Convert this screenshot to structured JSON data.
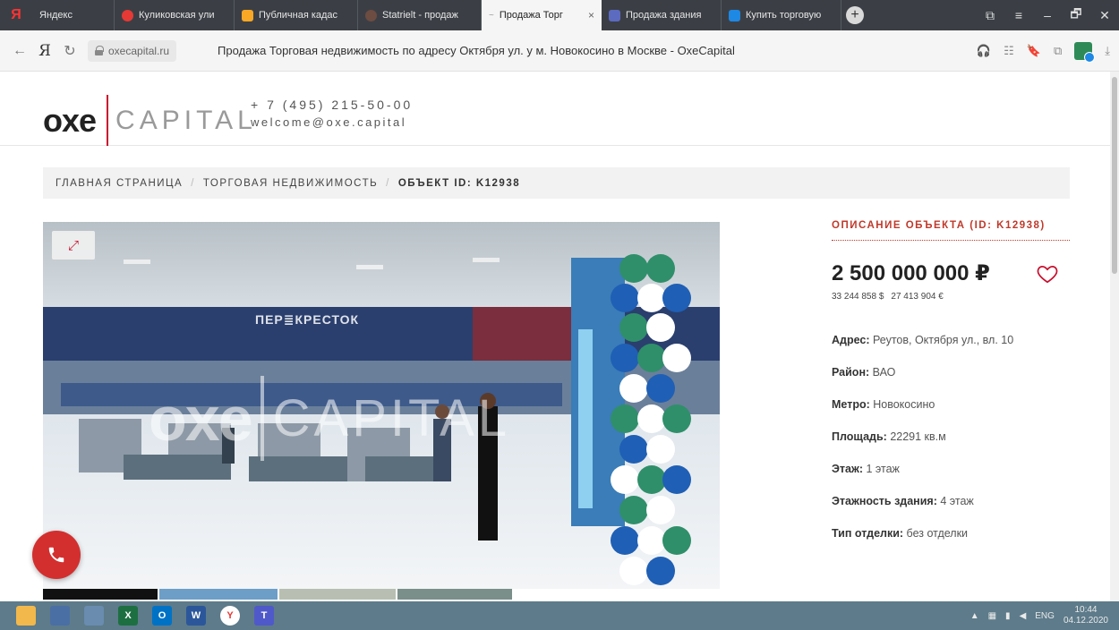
{
  "browser": {
    "yandex_glyph": "Я",
    "tabs": [
      {
        "label": "Яндекс",
        "favicon_color": "#3b3f45"
      },
      {
        "label": "Куликовская ули",
        "favicon_color": "#e53935"
      },
      {
        "label": "Публичная кадас",
        "favicon_color": "#f9a825"
      },
      {
        "label": "Statrielt - продаж",
        "favicon_color": "#6d4c41"
      },
      {
        "label": "Продажа Торг",
        "favicon_color": "#c8102e",
        "active": true
      },
      {
        "label": "Продажа здания",
        "favicon_color": "#5c6bc0"
      },
      {
        "label": "Купить торговую",
        "favicon_color": "#1e88e5"
      }
    ],
    "new_tab_glyph": "+",
    "close_glyph": "×",
    "window_controls": [
      "⧉",
      "≡",
      "‒",
      "🗗",
      "✕"
    ],
    "address": {
      "domain": "oxecapital.ru",
      "page_title": "Продажа Торговая недвижимость по адресу Октября ул. у м. Новокосино в Москве - OxeCapital"
    },
    "nav_glyphs": {
      "back": "←",
      "yandex": "Я",
      "reload": "↻"
    },
    "right_glyphs": [
      "🎧",
      "☷",
      "🔖",
      "⧉"
    ],
    "download_glyph": "⤓"
  },
  "site": {
    "logo": {
      "oxe": "oxe",
      "capital": "CAPITAL"
    },
    "phone": "+ 7 (495) 215-50-00",
    "email": "welcome@oxe.capital"
  },
  "breadcrumb": {
    "items": [
      "ГЛАВНАЯ СТРАНИЦА",
      "ТОРГОВАЯ НЕДВИЖИМОСТЬ"
    ],
    "current": "ОБЪЕКТ ID: K12938",
    "separator": "/"
  },
  "gallery": {
    "expand_glyph": "⤢",
    "store_sign": "ПЕР≣КРЕСТОК",
    "watermark": {
      "oxe": "oxe",
      "capital": "CAPITAL"
    }
  },
  "object": {
    "section_title": "ОПИСАНИЕ ОБЪЕКТА (ID: K12938)",
    "price": "2 500 000 000 ₽",
    "price_usd": "33 244 858 $",
    "price_eur": "27 413 904 €",
    "properties": [
      {
        "label": "Адрес:",
        "value": " Реутов, Октября ул., вл. 10"
      },
      {
        "label": "Район:",
        "value": " ВАО"
      },
      {
        "label": "Метро:",
        "value": " Новокосино"
      },
      {
        "label": "Площадь:",
        "value": " 22291 кв.м"
      },
      {
        "label": "Этаж:",
        "value": " 1 этаж"
      },
      {
        "label": "Этажность здания:",
        "value": " 4 этаж"
      },
      {
        "label": "Тип отделки:",
        "value": " без отделки"
      }
    ]
  },
  "taskbar": {
    "apps": [
      {
        "name": "explorer",
        "color": "#f2b84b",
        "glyph": ""
      },
      {
        "name": "app-chart",
        "color": "#4a6fa5",
        "glyph": ""
      },
      {
        "name": "paint",
        "color": "#6a8caf",
        "glyph": ""
      },
      {
        "name": "excel",
        "color": "#1d6f42",
        "glyph": "X"
      },
      {
        "name": "outlook",
        "color": "#0072c6",
        "glyph": "O"
      },
      {
        "name": "word",
        "color": "#2b579a",
        "glyph": "W"
      },
      {
        "name": "yandex-browser",
        "color": "#ffffff",
        "glyph": "Y"
      },
      {
        "name": "teams",
        "color": "#5059c9",
        "glyph": "T"
      }
    ],
    "language": "ENG",
    "time": "10:44",
    "date": "04.12.2020"
  }
}
